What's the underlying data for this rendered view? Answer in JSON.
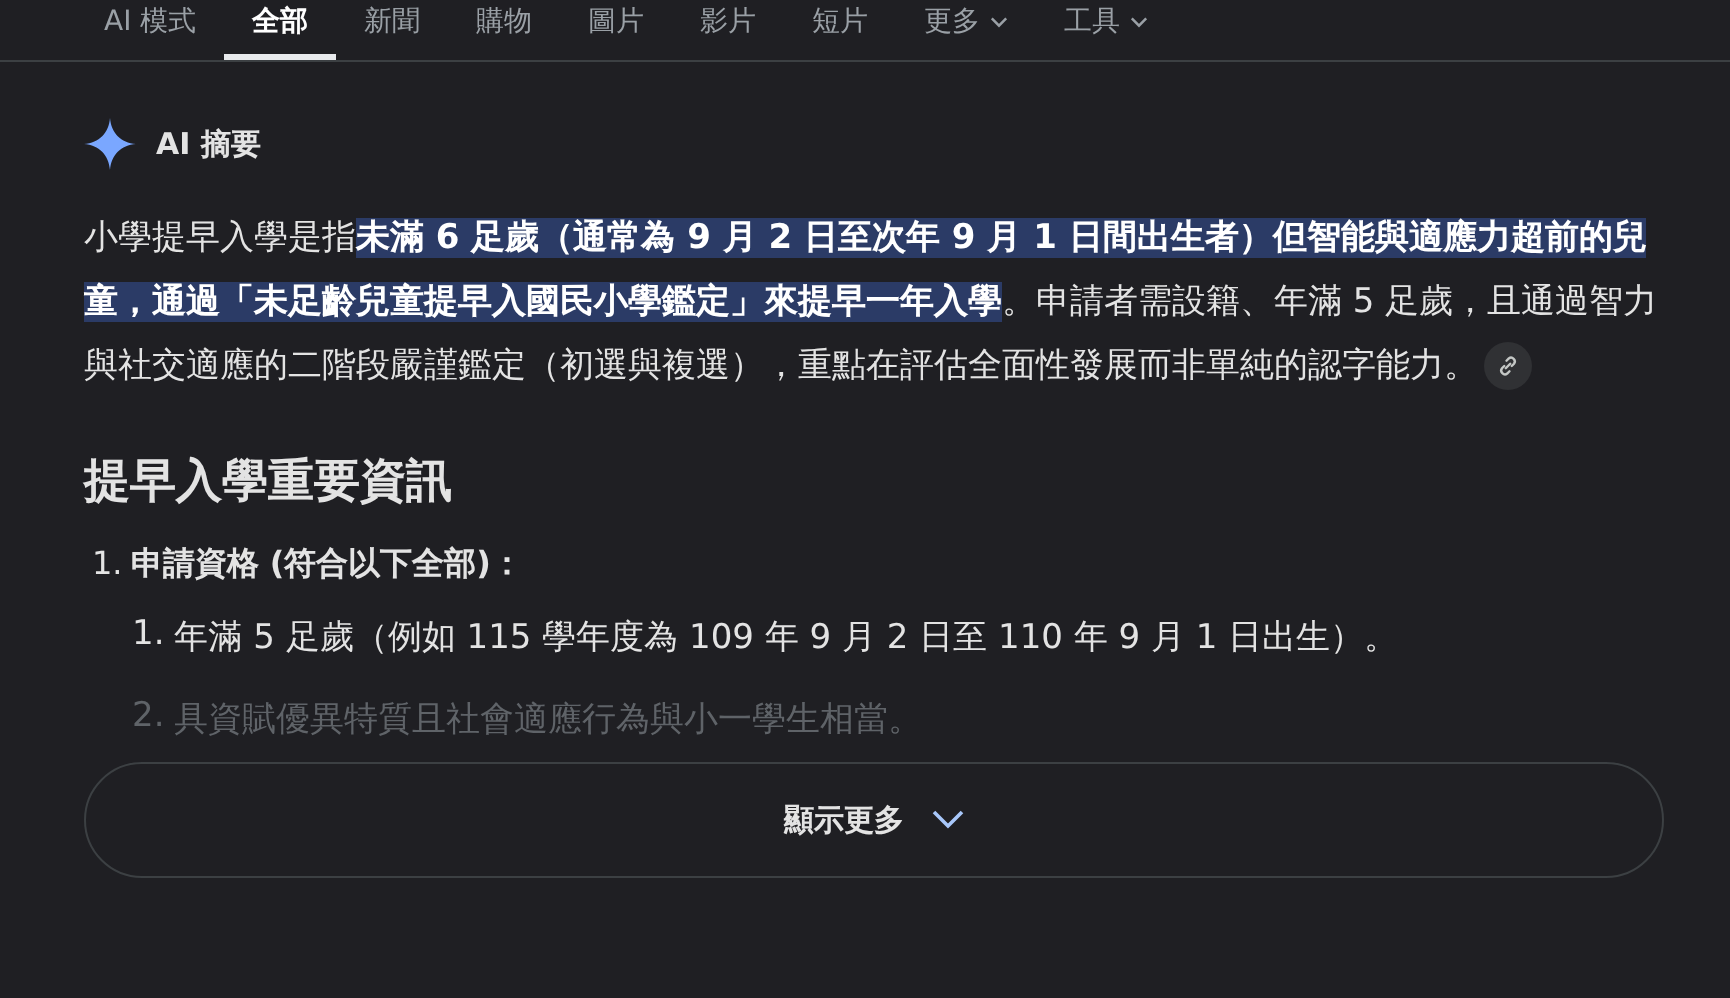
{
  "tabs": [
    {
      "label": "AI 模式",
      "selected": false
    },
    {
      "label": "全部",
      "selected": true
    },
    {
      "label": "新聞",
      "selected": false
    },
    {
      "label": "購物",
      "selected": false
    },
    {
      "label": "圖片",
      "selected": false
    },
    {
      "label": "影片",
      "selected": false
    },
    {
      "label": "短片",
      "selected": false
    },
    {
      "label": "更多",
      "selected": false,
      "dropdown": true
    },
    {
      "label": "工具",
      "selected": false,
      "dropdown": true
    }
  ],
  "overview": {
    "title": "AI 摘要",
    "summary": "小學提早入學是指**未滿 6 足歲（通常為 9 月 2 日至次年 9 月 1 日間出生者）但智能與適應力超前的兒童，通過「未足齡兒童提早入國民小學鑑定」來提早一年入學**。申請者需設籍、年滿 5 足歲，且通過智力與社交適應的二階段嚴謹鑑定（初選與複選），重點在評估全面性發展而非單純的認字能力。",
    "heading": "提早入學重要資訊",
    "list": [
      {
        "number": "1.",
        "label": "申請資格 (符合以下全部)：",
        "children": [
          {
            "number": "1.",
            "text": "年滿 5 足歲（例如 115 學年度為 109 年 9 月 2 日至 110 年 9 月 1 日出生）。",
            "faded": false
          },
          {
            "number": "2.",
            "text": "具資賦優異特質且社會適應行為與小一學生相當。",
            "faded": true
          }
        ]
      }
    ],
    "show_more": "顯示更多"
  }
}
